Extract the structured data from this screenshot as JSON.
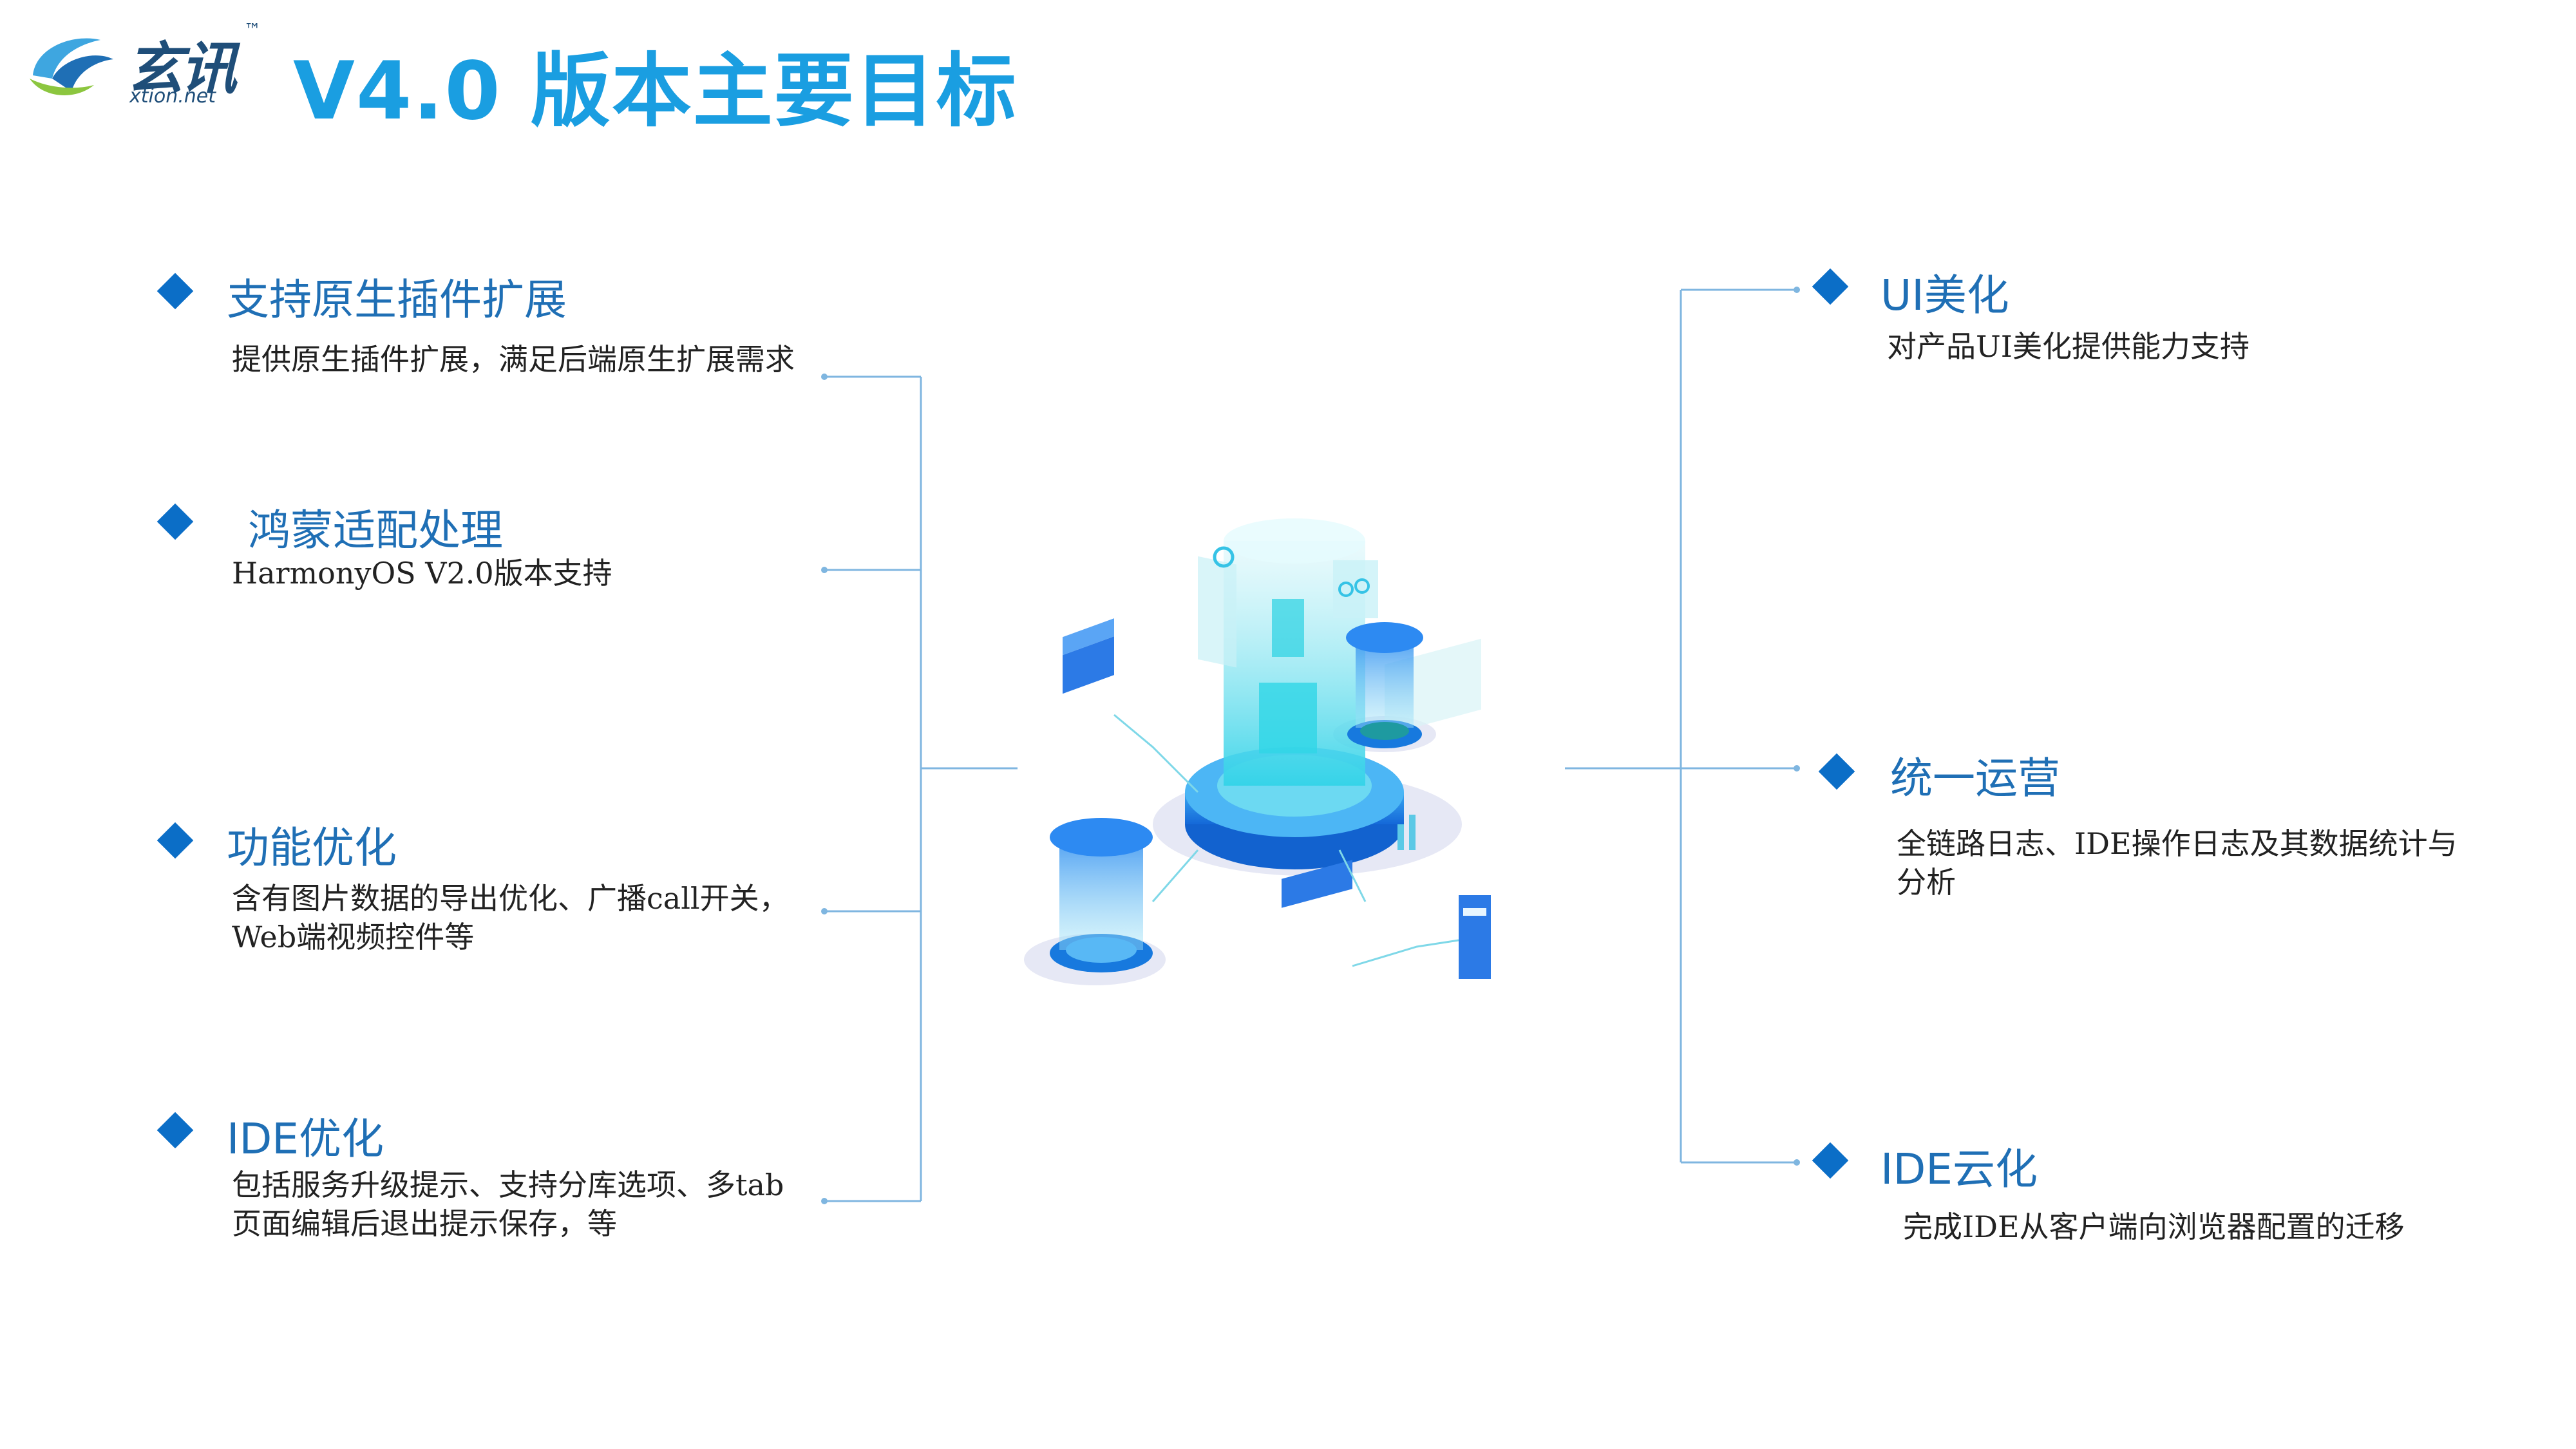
{
  "logo": {
    "name_cn": "玄讯",
    "trademark": "™",
    "domain": "xtion.net"
  },
  "title": "V4.0 版本主要目标",
  "left_items": [
    {
      "title": "支持原生插件扩展",
      "desc": "提供原生插件扩展，满足后端原生扩展需求"
    },
    {
      "title": "鸿蒙适配处理",
      "desc": "HarmonyOS V2.0版本支持"
    },
    {
      "title": "功能优化",
      "desc": "含有图片数据的导出优化、广播call开关，Web端视频控件等"
    },
    {
      "title": "IDE优化",
      "desc": "包括服务升级提示、支持分库选项、多tab页面编辑后退出提示保存，等"
    }
  ],
  "right_items": [
    {
      "title": "UI美化",
      "desc": "对产品UI美化提供能力支持"
    },
    {
      "title": "统一运营",
      "desc": "全链路日志、IDE操作日志及其数据统计与分析"
    },
    {
      "title": "IDE云化",
      "desc": "完成IDE从客户端向浏览器配置的迁移"
    }
  ],
  "colors": {
    "title": "#1a9ee1",
    "item_title": "#1f6fb5",
    "diamond": "#0b6ec7",
    "connector": "#7fb6e0"
  },
  "icons": [
    "logo-swirl-icon",
    "data-center-illustration"
  ]
}
